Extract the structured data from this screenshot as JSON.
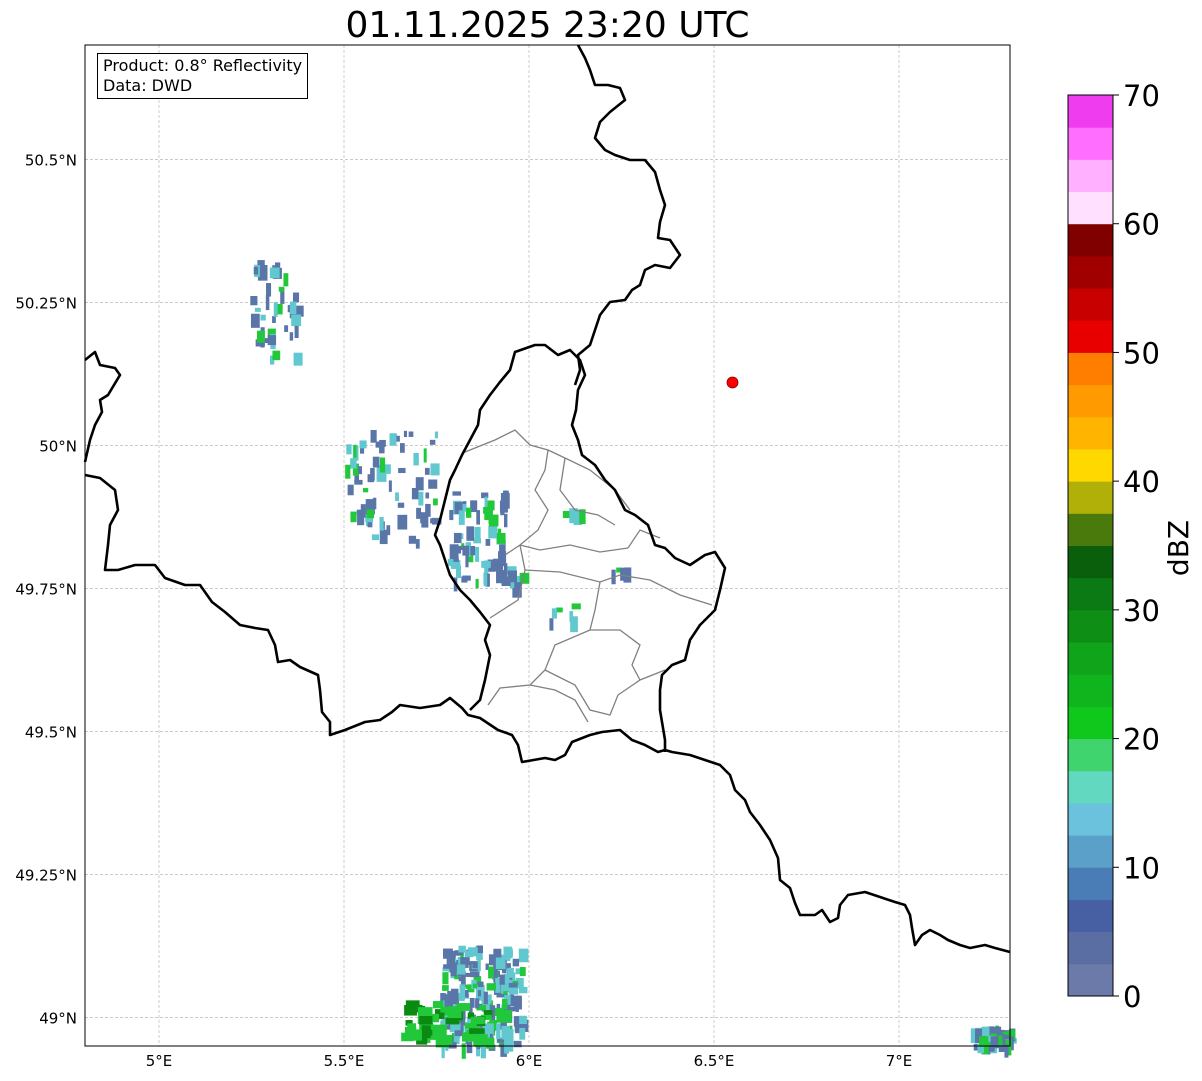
{
  "title": "01.11.2025 23:20 UTC",
  "info_box": {
    "product": "Product: 0.8° Reflectivity",
    "source": "Data: DWD"
  },
  "map": {
    "lon_range": [
      4.8,
      7.3
    ],
    "lat_range": [
      48.95,
      50.7
    ],
    "lon_ticks": [
      {
        "value": 5.0,
        "label": "5°E"
      },
      {
        "value": 5.5,
        "label": "5.5°E"
      },
      {
        "value": 6.0,
        "label": "6°E"
      },
      {
        "value": 6.5,
        "label": "6.5°E"
      },
      {
        "value": 7.0,
        "label": "7°E"
      }
    ],
    "lat_ticks": [
      {
        "value": 49.0,
        "label": "49°N"
      },
      {
        "value": 49.25,
        "label": "49.25°N"
      },
      {
        "value": 49.5,
        "label": "49.5°N"
      },
      {
        "value": 49.75,
        "label": "49.75°N"
      },
      {
        "value": 50.0,
        "label": "50°N"
      },
      {
        "value": 50.25,
        "label": "50.25°N"
      },
      {
        "value": 50.5,
        "label": "50.5°N"
      }
    ],
    "gridlines": "dashed",
    "marker": {
      "lon": 6.55,
      "lat": 50.11,
      "color": "#ff0000"
    }
  },
  "colorbar": {
    "label": "dBZ",
    "min": 0,
    "max": 70,
    "tick_labels": [
      "0",
      "10",
      "20",
      "30",
      "40",
      "50",
      "60",
      "70"
    ],
    "colors": [
      "#6b7aa8",
      "#5a6ea3",
      "#4660a3",
      "#4a7db5",
      "#5aa0c8",
      "#6ac2dd",
      "#62d8c0",
      "#3fd46e",
      "#10c81c",
      "#10b41c",
      "#10a41a",
      "#0f8e16",
      "#0c7a14",
      "#0a5f0c",
      "#4a7a0c",
      "#b0b008",
      "#ffd800",
      "#ffb400",
      "#ff9a00",
      "#ff7e00",
      "#e80000",
      "#c80000",
      "#a00000",
      "#800000",
      "#ffe0ff",
      "#ffb0ff",
      "#ff6eff",
      "#ee3cee"
    ]
  },
  "echo_colors": {
    "light": "#5a76a8",
    "mid": "#62c8d0",
    "green": "#20c83a",
    "dark": "#0a8a10"
  }
}
